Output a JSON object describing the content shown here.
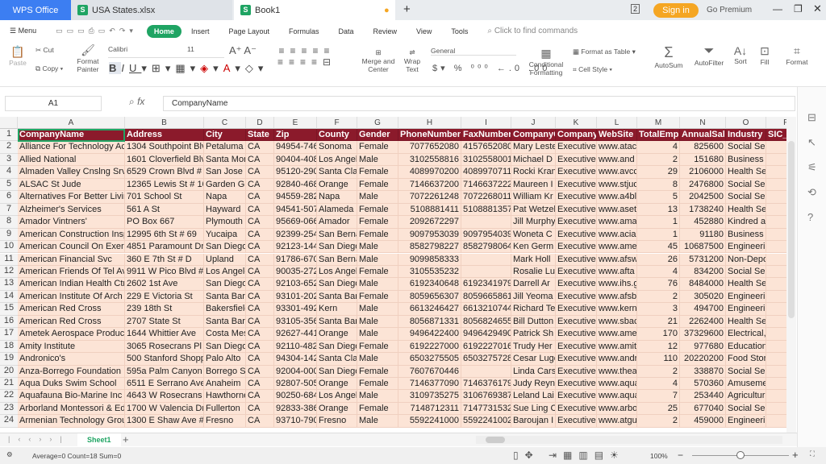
{
  "titlebar": {
    "app": "WPS Office",
    "tabs": [
      "USA States.xlsx",
      "Book1"
    ],
    "signin": "Sign in",
    "premium": "Go Premium",
    "badge": "2"
  },
  "menu": {
    "main": "Menu",
    "items": [
      "Home",
      "Insert",
      "Page Layout",
      "Formulas",
      "Data",
      "Review",
      "View",
      "Tools"
    ],
    "search": "Click to find commands"
  },
  "ribbon": {
    "paste": "Paste",
    "cut": "Cut",
    "copy": "Copy",
    "format_painter": "Format Painter",
    "font": "Calibri",
    "size": "11",
    "merge": "Merge and Center",
    "wrap": "Wrap Text",
    "number_format": "General",
    "cond_format": "Conditional Formatting",
    "format_table": "Format as Table",
    "cell_style": "Cell Style",
    "autosum": "AutoSum",
    "autofilter": "AutoFilter",
    "sort": "Sort",
    "fill": "Fill",
    "format": "Format"
  },
  "formula_bar": {
    "name_box": "A1",
    "fx": "fx",
    "value": "CompanyName"
  },
  "columns": [
    "A",
    "B",
    "C",
    "D",
    "E",
    "F",
    "G",
    "H",
    "I",
    "J",
    "K",
    "L",
    "M",
    "N",
    "O",
    "P"
  ],
  "header": [
    "CompanyName",
    "Address",
    "City",
    "State",
    "Zip",
    "County",
    "Gender",
    "PhoneNumber",
    "FaxNumber",
    "CompanyContact",
    "CompanyContactTitle",
    "WebSite",
    "TotalEmployees",
    "AnnualSales",
    "Industry",
    "SIC_Code"
  ],
  "rows": [
    [
      "Alliance For Technology Access",
      "1304 Southpoint Blvd",
      "Petaluma",
      "CA",
      "94954-7468",
      "Sonoma",
      "Female",
      "7077652080",
      "4157652080",
      "Mary Lester",
      "Executive",
      "www.atac",
      "4",
      "825600",
      "Social Services",
      ""
    ],
    [
      "Allied National",
      "1601 Cloverfield Blvd",
      "Santa Monica",
      "CA",
      "90404-4082",
      "Los Angeles",
      "Male",
      "3102558816",
      "3102558001",
      "Michael D",
      "Executive",
      "www.and",
      "2",
      "151680",
      "Business Services",
      ""
    ],
    [
      "Almaden Valley Cnslng Srv",
      "6529 Crown Blvd # D",
      "San Jose",
      "CA",
      "95120-2900",
      "Santa Clara",
      "Female",
      "4089970200",
      "4089970711",
      "Rocki Kran",
      "Executive",
      "www.avcc",
      "29",
      "2106000",
      "Health Services",
      ""
    ],
    [
      "ALSAC St Jude",
      "12365 Lewis St # 103",
      "Garden Grove",
      "CA",
      "92840-4688",
      "Orange",
      "Female",
      "7146637200",
      "7146637222",
      "Maureen I",
      "Executive",
      "www.stjude",
      "8",
      "2476800",
      "Social Services",
      ""
    ],
    [
      "Alternatives For Better Living",
      "701 School St",
      "Napa",
      "CA",
      "94559-2823",
      "Napa",
      "Male",
      "7072261248",
      "7072268011",
      "William Kr",
      "Executive",
      "www.a4bl",
      "5",
      "2042500",
      "Social Services",
      ""
    ],
    [
      "Alzheimer's Services",
      "561 A St",
      "Hayward",
      "CA",
      "94541-5071",
      "Alameda",
      "Female",
      "5108881411",
      "5108881357",
      "Pat Wetzel",
      "Executive",
      "www.aset",
      "13",
      "1738240",
      "Health Services",
      ""
    ],
    [
      "Amador Vintners'",
      "PO Box 667",
      "Plymouth",
      "CA",
      "95669-0666",
      "Amador",
      "Female",
      "2092672297",
      "",
      "Jill Murphy",
      "Executive",
      "www.ama",
      "1",
      "452880",
      "Kindred and",
      ""
    ],
    [
      "American Construction Insp",
      "12995 6th St # 69",
      "Yucaipa",
      "CA",
      "92399-2544",
      "San Bernardino",
      "Female",
      "9097953039",
      "9097954039",
      "Woneta C",
      "Executive",
      "www.acia",
      "1",
      "91180",
      "Business Services",
      ""
    ],
    [
      "American Council On Exercise",
      "4851 Paramount Dr",
      "San Diego",
      "CA",
      "92123-1449",
      "San Diego",
      "Male",
      "8582798227",
      "8582798064",
      "Ken Germ",
      "Executive",
      "www.ame",
      "45",
      "10687500",
      "Engineering",
      ""
    ],
    [
      "American Financial Svc",
      "360 E 7th St # D",
      "Upland",
      "CA",
      "91786-6700",
      "San Bernardino",
      "Male",
      "9099858333",
      "",
      "Mark Holl",
      "Executive",
      "www.afsw",
      "26",
      "5731200",
      "Non-Depository",
      ""
    ],
    [
      "American Friends Of Tel Aviv",
      "9911 W Pico Blvd # 1",
      "Los Angeles",
      "CA",
      "90035-2724",
      "Los Angeles",
      "Female",
      "3105535232",
      "",
      "Rosalie Lu",
      "Executive",
      "www.afta",
      "4",
      "834200",
      "Social Services",
      ""
    ],
    [
      "American Indian Health Ctr",
      "2602 1st Ave",
      "San Diego",
      "CA",
      "92103-6521",
      "San Diego",
      "Male",
      "6192340648",
      "6192341979",
      "Darrell Ar",
      "Executive",
      "www.ihs.gov",
      "76",
      "8484000",
      "Health Services",
      ""
    ],
    [
      "American Institute Of Arch",
      "229 E Victoria St",
      "Santa Barbara",
      "CA",
      "93101-2021",
      "Santa Barbara",
      "Female",
      "8059656307",
      "8059665861",
      "Jill Yeoma",
      "Executive",
      "www.afsb",
      "2",
      "305020",
      "Engineering",
      ""
    ],
    [
      "American Red Cross",
      "239 18th St",
      "Bakersfield",
      "CA",
      "93301-4925",
      "Kern",
      "Male",
      "6613246427",
      "6613210744",
      "Richard Te",
      "Executive",
      "www.kern",
      "3",
      "494700",
      "Engineering",
      ""
    ],
    [
      "American Red Cross",
      "2707 State St",
      "Santa Barbara",
      "CA",
      "93105-3566",
      "Santa Barbara",
      "Male",
      "8056871331",
      "8056824655",
      "Bill Dutton",
      "Executive",
      "www.sbac",
      "21",
      "2262400",
      "Health Services",
      ""
    ],
    [
      "Ametek Aerospace Products",
      "1644 Whittier Ave",
      "Costa Mesa",
      "CA",
      "92627-4410",
      "Orange",
      "Male",
      "9496422400",
      "9496429490",
      "Patrick Sh",
      "Executive",
      "www.ame",
      "170",
      "37329600",
      "Electrical,",
      ""
    ],
    [
      "Amity Institute",
      "3065 Rosecrans Pl # 1",
      "San Diego",
      "CA",
      "92110-4821",
      "San Diego",
      "Female",
      "6192227000",
      "6192227016",
      "Trudy Her",
      "Executive",
      "www.amit",
      "12",
      "977680",
      "Education",
      ""
    ],
    [
      "Andronico's",
      "500 Stanford Shopping",
      "Palo Alto",
      "CA",
      "94304-1422",
      "Santa Clara",
      "Male",
      "6503275505",
      "6503275728",
      "Cesar Lugo",
      "Executive",
      "www.andr",
      "110",
      "20220200",
      "Food Stores",
      ""
    ],
    [
      "Anza-Borrego Foundation",
      "595a Palm Canyon Dr",
      "Borrego Springs",
      "CA",
      "92004-0000",
      "San Diego",
      "Female",
      "7607670446",
      "",
      "Linda Cars",
      "Executive",
      "www.thea",
      "2",
      "338870",
      "Social Services",
      ""
    ],
    [
      "Aqua Duks Swim School",
      "6511 E Serrano Ave",
      "Anaheim",
      "CA",
      "92807-5055",
      "Orange",
      "Female",
      "7146377090",
      "7146376179",
      "Judy Reyn",
      "Executive",
      "www.aqua",
      "4",
      "570360",
      "Amusement",
      ""
    ],
    [
      "Aquafauna Bio-Marine Inc",
      "4643 W Rosecrans Ave",
      "Hawthorne",
      "CA",
      "90250-6844",
      "Los Angeles",
      "Male",
      "3109735275",
      "3106769387",
      "Leland Lai",
      "Executive",
      "www.aqua",
      "7",
      "253440",
      "Agricultural",
      ""
    ],
    [
      "Arborland Montessori & Ed",
      "1700 W Valencia Dr",
      "Fullerton",
      "CA",
      "92833-3866",
      "Orange",
      "Female",
      "7148712311",
      "7147731532",
      "Sue Ling C",
      "Executive",
      "www.arbo",
      "25",
      "677040",
      "Social Services",
      ""
    ],
    [
      "Armenian Technology Group",
      "1300 E Shaw Ave # 1",
      "Fresno",
      "CA",
      "93710-7900",
      "Fresno",
      "Male",
      "5592241000",
      "5592241002",
      "Baroujan I",
      "Executive",
      "www.atgu",
      "2",
      "459000",
      "Engineering",
      ""
    ]
  ],
  "sheets": {
    "active": "Sheet1",
    "add": "+"
  },
  "status": {
    "summary": "Average=0  Count=18  Sum=0",
    "zoom": "100%",
    "zoom_level": 100
  },
  "colors": {
    "header_fill": "#8b1a2b",
    "cell_fill": "#fce4d6",
    "accent": "#1fa463"
  }
}
